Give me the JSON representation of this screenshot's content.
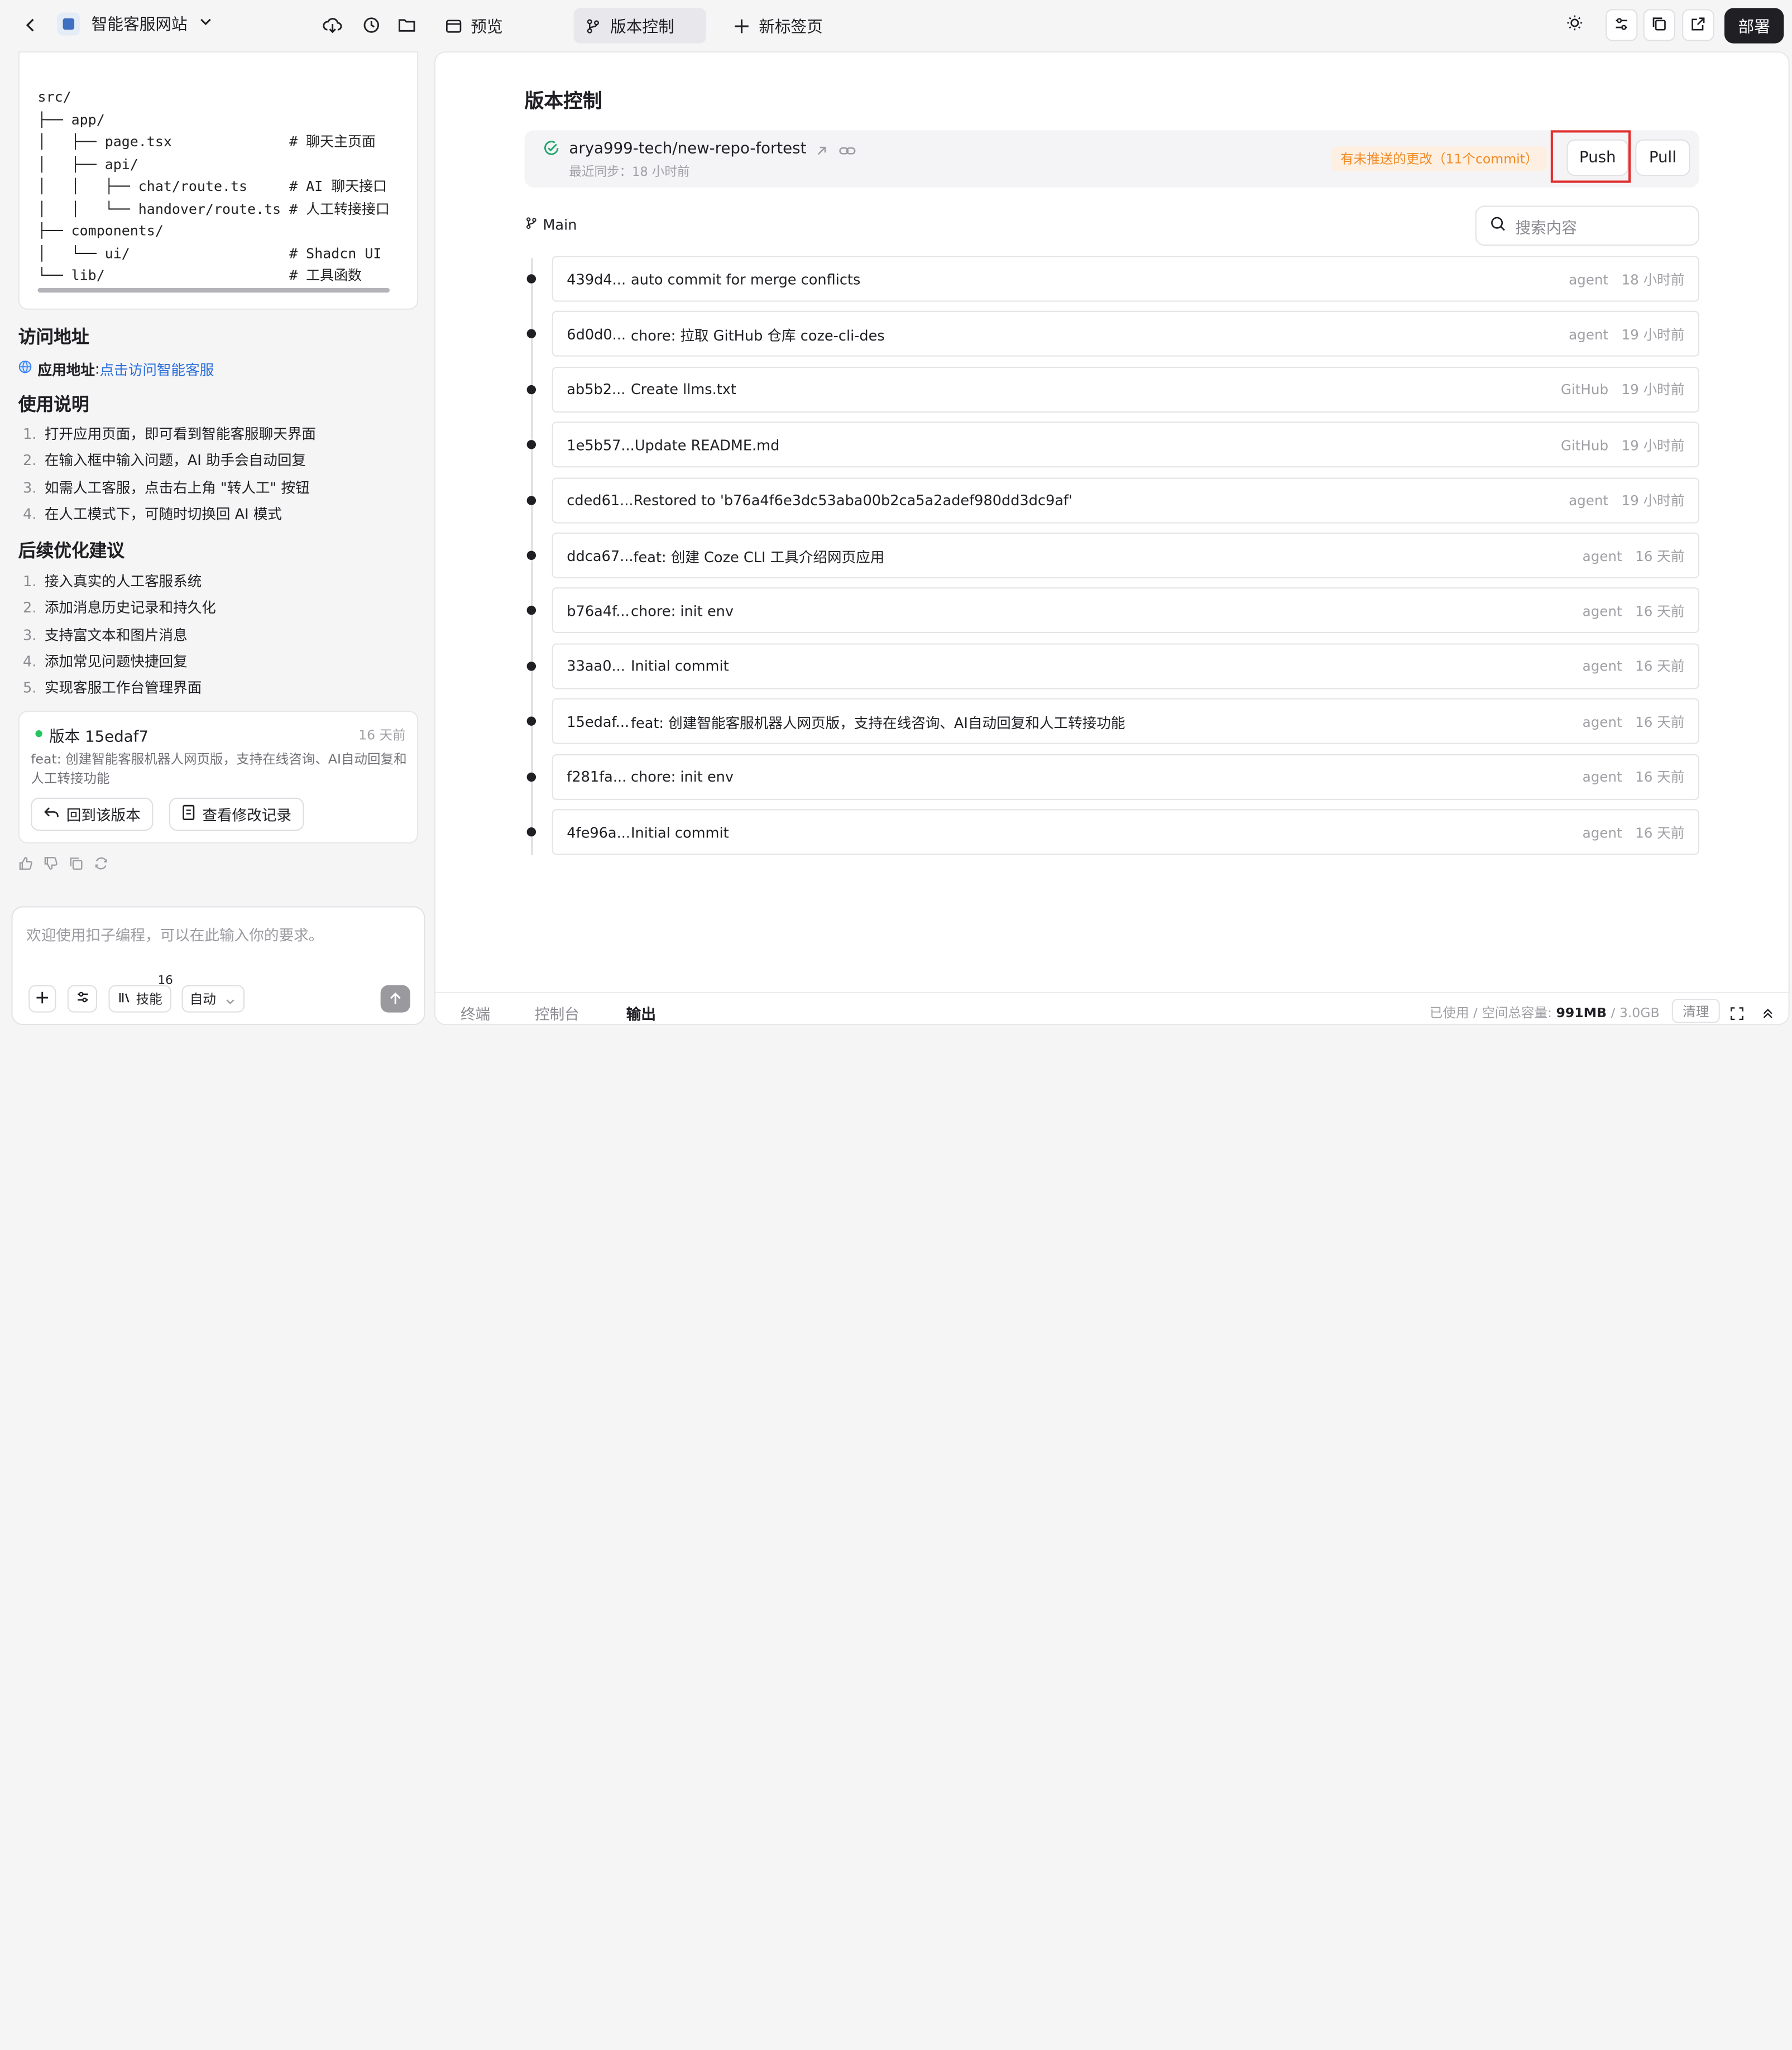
{
  "topbar": {
    "project_name": "智能客服网站",
    "preview_label": "预览",
    "version_control_label": "版本控制",
    "new_tab_label": "新标签页",
    "deploy_label": "部署"
  },
  "left": {
    "code_lines": "src/\n├── app/\n│   ├── page.tsx              # 聊天主页面\n│   ├── api/\n│   │   ├── chat/route.ts     # AI 聊天接口\n│   │   └── handover/route.ts # 人工转接接口\n├── components/\n│   └── ui/                   # Shadcn UI\n└── lib/                      # 工具函数",
    "access_heading": "访问地址",
    "app_url_label": "应用地址",
    "app_url_link": "点击访问智能客服",
    "usage_heading": "使用说明",
    "usage_items": [
      "打开应用页面，即可看到智能客服聊天界面",
      "在输入框中输入问题，AI 助手会自动回复",
      "如需人工客服，点击右上角 \"转人工\" 按钮",
      "在人工模式下，可随时切换回 AI 模式"
    ],
    "future_heading": "后续优化建议",
    "future_items": [
      "接入真实的人工客服系统",
      "添加消息历史记录和持久化",
      "支持富文本和图片消息",
      "添加常见问题快捷回复",
      "实现客服工作台管理界面"
    ],
    "version_card": {
      "title": "版本 15edaf7",
      "time": "16 天前",
      "desc": "feat: 创建智能客服机器人网页版，支持在线咨询、AI自动回复和人工转接功能",
      "rollback_label": "回到该版本",
      "view_changes_label": "查看修改记录"
    },
    "input_placeholder": "欢迎使用扣子编程，可以在此输入你的要求。",
    "skills_label": "技能",
    "skills_count": "16",
    "mode_label": "自动"
  },
  "main": {
    "title": "版本控制",
    "repo_name": "arya999-tech/new-repo-fortest",
    "last_sync": "最近同步：18 小时前",
    "unpushed_tag": "有未推送的更改（11个commit）",
    "push_label": "Push",
    "pull_label": "Pull",
    "branch_name": "Main",
    "search_placeholder": "搜索内容",
    "commits": [
      {
        "hash": "439d4...",
        "msg": "auto commit for merge conflicts",
        "author": "agent",
        "time": "18 小时前"
      },
      {
        "hash": "6d0d0...",
        "msg": "chore: 拉取 GitHub 仓库 coze-cli-des",
        "author": "agent",
        "time": "19 小时前"
      },
      {
        "hash": "ab5b2...",
        "msg": "Create llms.txt",
        "author": "GitHub",
        "time": "19 小时前"
      },
      {
        "hash": "1e5b57...",
        "msg": "Update README.md",
        "author": "GitHub",
        "time": "19 小时前"
      },
      {
        "hash": "cded61...",
        "msg": "Restored to 'b76a4f6e3dc53aba00b2ca5a2adef980dd3dc9af'",
        "author": "agent",
        "time": "19 小时前"
      },
      {
        "hash": "ddca67...",
        "msg": "feat: 创建 Coze CLI 工具介绍网页应用",
        "author": "agent",
        "time": "16 天前"
      },
      {
        "hash": "b76a4f...",
        "msg": "chore: init env",
        "author": "agent",
        "time": "16 天前"
      },
      {
        "hash": "33aa0...",
        "msg": "Initial commit",
        "author": "agent",
        "time": "16 天前"
      },
      {
        "hash": "15edaf...",
        "msg": "feat: 创建智能客服机器人网页版，支持在线咨询、AI自动回复和人工转接功能",
        "author": "agent",
        "time": "16 天前"
      },
      {
        "hash": "f281fa...",
        "msg": "chore: init env",
        "author": "agent",
        "time": "16 天前"
      },
      {
        "hash": "4fe96a...",
        "msg": "Initial commit",
        "author": "agent",
        "time": "16 天前"
      }
    ],
    "bottom_tabs": [
      "终端",
      "控制台",
      "输出"
    ],
    "storage_label": "已使用 / 空间总容量:",
    "storage_used": "991MB",
    "storage_total": "/ 3.0GB",
    "clean_label": "清理"
  },
  "colors": {
    "accent_warn": "#f08a24",
    "link": "#2a6fdb",
    "green": "#22c55e",
    "highlight": "#e02d2d"
  }
}
